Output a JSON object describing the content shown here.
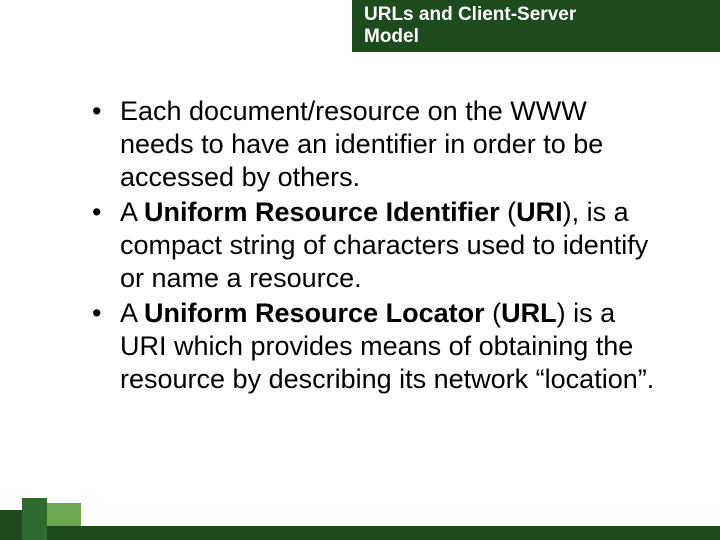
{
  "title": {
    "line1": "URLs and Client-Server",
    "line2": "Model"
  },
  "bullets": [
    {
      "runs": [
        {
          "t": "Each document/resource on the WWW needs to have an identifier in order to be accessed by others.",
          "b": false
        }
      ]
    },
    {
      "runs": [
        {
          "t": "A ",
          "b": false
        },
        {
          "t": "Uniform Resource Identifier",
          "b": true
        },
        {
          "t": " (",
          "b": false
        },
        {
          "t": "URI",
          "b": true
        },
        {
          "t": "), is a compact string of characters used to identify or name a resource.",
          "b": false
        }
      ]
    },
    {
      "runs": [
        {
          "t": "A ",
          "b": false
        },
        {
          "t": "Uniform Resource Locator",
          "b": true
        },
        {
          "t": " (",
          "b": false
        },
        {
          "t": "URL",
          "b": true
        },
        {
          "t": ") is a URI which provides means of obtaining the resource by describing its network “location”.",
          "b": false
        }
      ]
    }
  ]
}
